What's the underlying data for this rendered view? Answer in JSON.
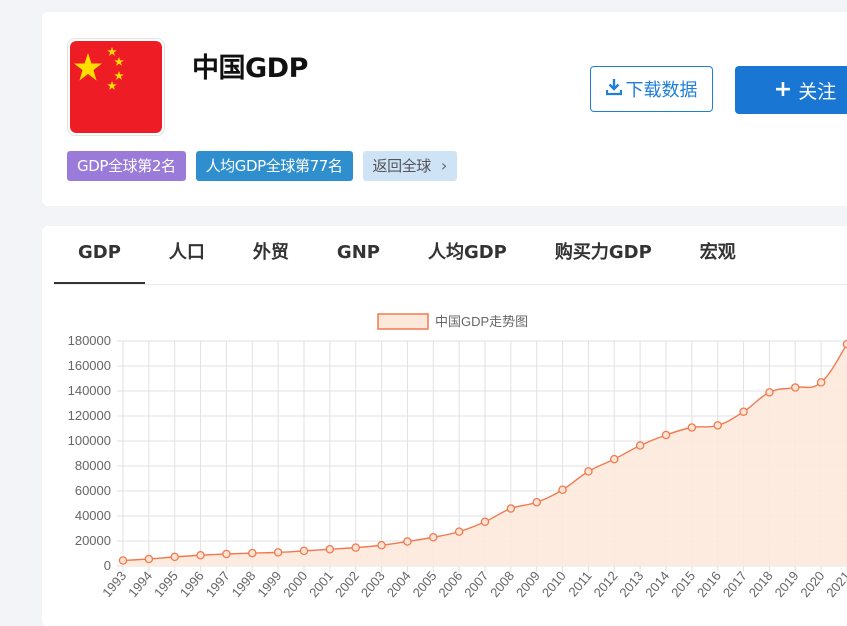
{
  "header": {
    "title": "中国GDP",
    "flag_icon": "china-flag-icon",
    "badges": {
      "rank": "GDP全球第2名",
      "per_capita_rank": "人均GDP全球第77名",
      "back": "返回全球"
    },
    "download_label": "下载数据",
    "follow_label": "关注"
  },
  "tabs": [
    "GDP",
    "人口",
    "外贸",
    "GNP",
    "人均GDP",
    "购买力GDP",
    "宏观"
  ],
  "colors": {
    "accent": "#1976d2",
    "line": "#f07a4f",
    "fill": "#fde9dc",
    "badge_rank": "#9a7bd9",
    "badge_per_capita": "#2f8fce",
    "badge_back": "#cfe3f7"
  },
  "chart_data": {
    "type": "area",
    "legend": "中国GDP走势图",
    "legend_position": "top-center",
    "grid": true,
    "ylim": [
      0,
      180000
    ],
    "yticks": [
      0,
      20000,
      40000,
      60000,
      80000,
      100000,
      120000,
      140000,
      160000,
      180000
    ],
    "categories": [
      "1993",
      "1994",
      "1995",
      "1996",
      "1997",
      "1998",
      "1999",
      "2000",
      "2001",
      "2002",
      "2003",
      "2004",
      "2005",
      "2006",
      "2007",
      "2008",
      "2009",
      "2010",
      "2011",
      "2012",
      "2013",
      "2014",
      "2015",
      "2016",
      "2017",
      "2018",
      "2019",
      "2020",
      "2021"
    ],
    "series": [
      {
        "name": "中国GDP走势图",
        "values": [
          4400,
          5600,
          7300,
          8600,
          9600,
          10300,
          10900,
          12100,
          13400,
          14700,
          16600,
          19600,
          23000,
          27500,
          35400,
          46000,
          51000,
          61000,
          75700,
          85500,
          96400,
          104800,
          110800,
          112500,
          123400,
          138900,
          142800,
          146900,
          177500
        ]
      }
    ]
  }
}
